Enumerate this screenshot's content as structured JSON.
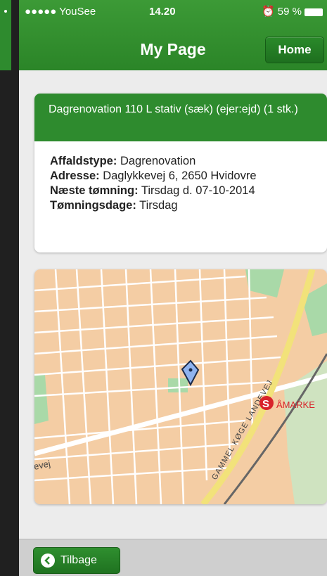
{
  "status_bar": {
    "carrier": "●●●●● YouSee",
    "time": "14.20",
    "battery": "59 %"
  },
  "header": {
    "title": "My Page",
    "home_label": "Home"
  },
  "card": {
    "title": "Dagrenovation 110 L stativ (sæk) (ejer:ejd) (1 stk.)",
    "fields": [
      {
        "label": "Affaldstype:",
        "value": "Dagrenovation"
      },
      {
        "label": "Adresse:",
        "value": "Daglykkevej 6, 2650 Hvidovre"
      },
      {
        "label": "Næste tømning:",
        "value": "Tirsdag d. 07-10-2014"
      },
      {
        "label": "Tømningsdage:",
        "value": "Tirsdag"
      }
    ]
  },
  "map": {
    "road_label": "GAMMEL KØGE LANDEVEJ",
    "street_label": "evej",
    "station_label": "ÅMARKE",
    "station_symbol": "S",
    "colors": {
      "land": "#f4cda4",
      "road": "#ffffff",
      "park": "#a9d9a8",
      "main_road": "#f2e27a"
    }
  },
  "footer": {
    "back_label": "Tilbage"
  },
  "colors": {
    "accent": "#2e8b2e",
    "background": "#ececec"
  }
}
